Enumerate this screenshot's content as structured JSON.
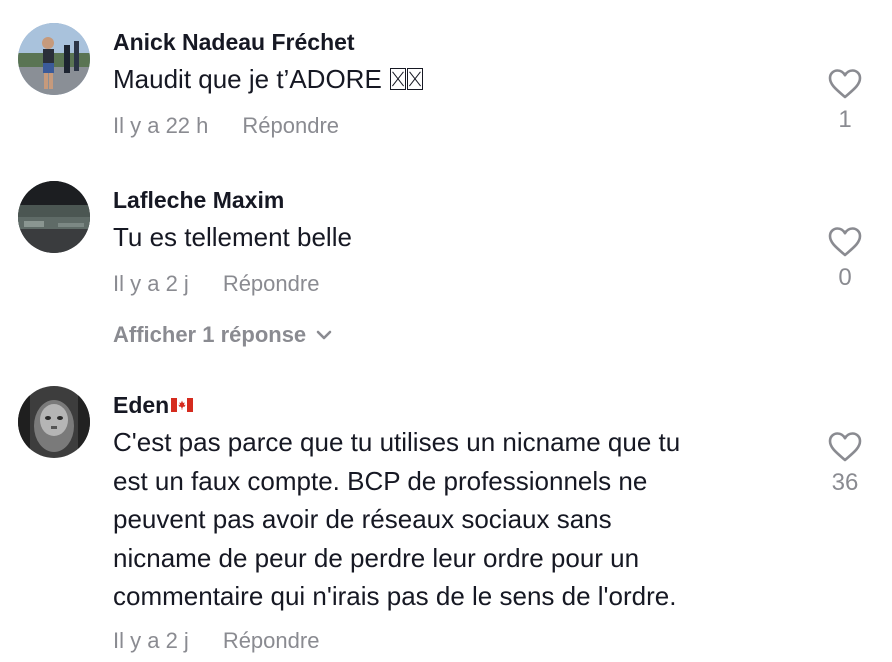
{
  "comments": [
    {
      "username": "Anick Nadeau Fréchet",
      "text_lines": [
        "Maudit que je t’ADORE"
      ],
      "trailing_glyphs": [
        "missing-emoji-box",
        "missing-emoji-box"
      ],
      "time": "Il y a 22 h",
      "reply_label": "Répondre",
      "likes": "1",
      "avatar": "runner-photo-avatar"
    },
    {
      "username": "Lafleche Maxim",
      "text_lines": [
        "Tu es tellement belle"
      ],
      "time": "Il y a 2 j",
      "reply_label": "Répondre",
      "likes": "0",
      "view_replies_label": "Afficher 1 réponse",
      "avatar": "dark-landscape-avatar"
    },
    {
      "username": "Eden",
      "username_flag": "canada-flag-icon",
      "text_lines": [
        "C'est pas parce que tu utilises un nicname que tu",
        "est un faux compte. BCP de professionnels ne",
        "peuvent pas avoir de réseaux sociaux sans",
        "nicname de peur de perdre leur ordre pour un",
        "commentaire qui n'irais pas de le sens de l'ordre."
      ],
      "time": "Il y a 2 j",
      "reply_label": "Répondre",
      "likes": "36",
      "avatar": "grayscale-portrait-avatar"
    }
  ],
  "colors": {
    "text": "#161823",
    "muted": "#8a8b91",
    "background": "#ffffff"
  },
  "icons": {
    "like": "heart-outline-icon",
    "expand": "chevron-down-icon"
  }
}
